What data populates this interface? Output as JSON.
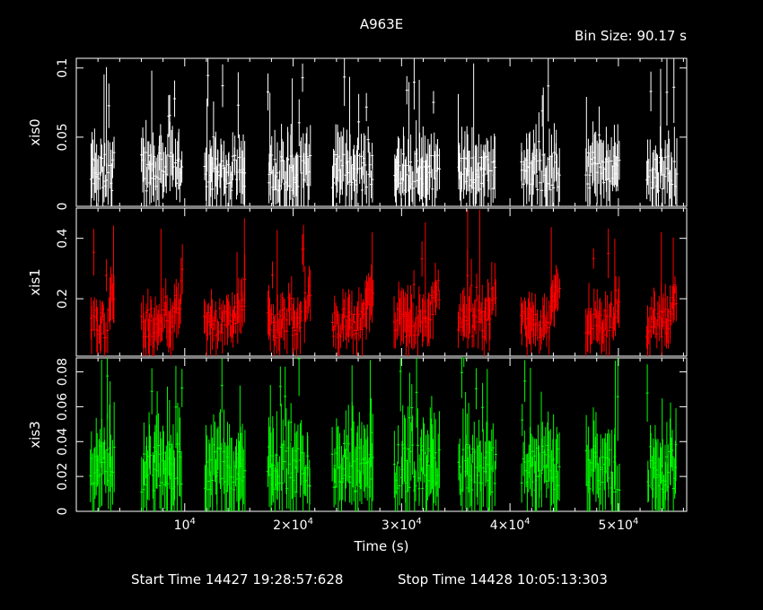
{
  "chart_data": {
    "type": "line",
    "title": "A963E",
    "bin_size_label": "Bin Size:  90.17 s",
    "xlabel": "Time (s)",
    "x_ticks": [
      {
        "value": 10000,
        "mantissa": "10",
        "exp": "4",
        "prefix": ""
      },
      {
        "value": 20000,
        "mantissa": "2×10",
        "exp": "4",
        "prefix": ""
      },
      {
        "value": 30000,
        "mantissa": "3×10",
        "exp": "4",
        "prefix": ""
      },
      {
        "value": 40000,
        "mantissa": "4×10",
        "exp": "4",
        "prefix": ""
      },
      {
        "value": 50000,
        "mantissa": "5×10",
        "exp": "4",
        "prefix": ""
      }
    ],
    "xlim": [
      0,
      56300
    ],
    "segments": [
      [
        1300,
        3500
      ],
      [
        6000,
        9800
      ],
      [
        11800,
        15600
      ],
      [
        17600,
        21600
      ],
      [
        23600,
        27400
      ],
      [
        29300,
        33500
      ],
      [
        35200,
        38700
      ],
      [
        41000,
        44600
      ],
      [
        47000,
        50100
      ],
      [
        52600,
        55400
      ]
    ],
    "panels": [
      {
        "name": "xis0",
        "color": "#ffffff",
        "ylim": [
          0,
          0.107
        ],
        "y_ticks": [
          {
            "value": 0,
            "label": "0"
          },
          {
            "value": 0.05,
            "label": "0.05"
          },
          {
            "value": 0.1,
            "label": "0.1"
          }
        ],
        "base": 0.025,
        "spread": 0.02,
        "peak": 0.105
      },
      {
        "name": "xis1",
        "color": "#ff0000",
        "ylim": [
          0.01,
          0.5
        ],
        "y_ticks": [
          {
            "value": 0.2,
            "label": "0.2"
          },
          {
            "value": 0.4,
            "label": "0.4"
          }
        ],
        "base": 0.12,
        "spread": 0.07,
        "peak": 0.5
      },
      {
        "name": "xis3",
        "color": "#00ff00",
        "ylim": [
          0,
          0.088
        ],
        "y_ticks": [
          {
            "value": 0,
            "label": "0"
          },
          {
            "value": 0.02,
            "label": "0.02"
          },
          {
            "value": 0.04,
            "label": "0.04"
          },
          {
            "value": 0.06,
            "label": "0.06"
          },
          {
            "value": 0.08,
            "label": "0.08"
          }
        ],
        "base": 0.025,
        "spread": 0.02,
        "peak": 0.088
      }
    ],
    "grid": false,
    "legend": "none"
  },
  "footer": {
    "start_time": "Start Time 14427 19:28:57:628",
    "stop_time": "Stop Time 14428 10:05:13:303"
  }
}
